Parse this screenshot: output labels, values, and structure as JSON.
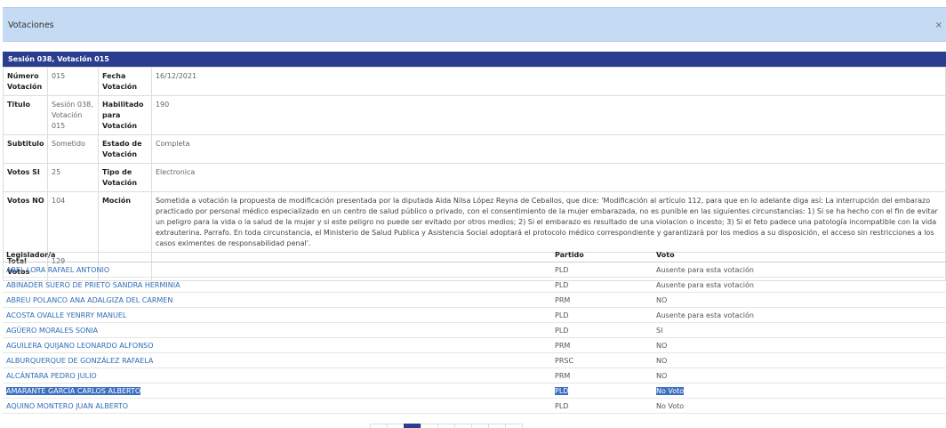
{
  "window": {
    "title": "Votaciones",
    "close": "×"
  },
  "session_title": "Sesión 038, Votación 015",
  "info": {
    "numero_label": "Número Votación",
    "numero": "015",
    "fecha_label": "Fecha Votación",
    "fecha": "16/12/2021",
    "titulo_label": "Titulo",
    "titulo": "Sesión 038, Votación 015",
    "habilitado_label": "Habilitado para Votación",
    "habilitado": "190",
    "subtitulo_label": "Subtitulo",
    "subtitulo": "Sometido",
    "estado_label": "Estado de Votación",
    "estado": "Completa",
    "votos_si_label": "Votos SI",
    "votos_si": "25",
    "tipo_label": "Tipo de Votación",
    "tipo": "Electronica",
    "votos_no_label": "Votos NO",
    "votos_no": "104",
    "mocion_label": "Moción",
    "mocion": "Sometida a votación la propuesta de modificación presentada por la diputada Aida Nilsa López Reyna de Ceballos, que dice: 'Modificación al artículo 112, para que en lo adelante diga así: La interrupción del embarazo practicado por personal médico especializado en un centro de salud público o privado, con el consentimiento de la mujer embarazada, no es punible en las siguientes circunstancias: 1) Si se ha hecho con el fin de evitar un peligro para la vida o la salud de la mujer y si este peligro no puede ser evitado por otros medios; 2) Si el embarazo es resultado de una violacion o incesto; 3) Si el feto padece una patología incompatible con la vida extrauterina. Parrafo. En toda circunstancia, el Ministerio de Salud Publica y Asistencia Social adoptará el protocolo médico correspondiente y garantizará por los medios a su disposición, el acceso sin restricciones a los casos eximentes de responsabilidad penal'.",
    "total_label": "Total Votos",
    "total": "129"
  },
  "votes_table": {
    "headers": {
      "legislador": "Legislador/a",
      "partido": "Partido",
      "voto": "Voto"
    },
    "rows": [
      {
        "name": "ABEL LORA RAFAEL ANTONIO",
        "party": "PLD",
        "vote": "Ausente para esta votación"
      },
      {
        "name": "ABINADER SUERO DE PRIETO SANDRA HERMINIA",
        "party": "PLD",
        "vote": "Ausente para esta votación"
      },
      {
        "name": "ABREU POLANCO ANA ADALGIZA DEL CARMEN",
        "party": "PRM",
        "vote": "NO"
      },
      {
        "name": "ACOSTA OVALLE YENRRY MANUEL",
        "party": "PLD",
        "vote": "Ausente para esta votación"
      },
      {
        "name": "AGÜERO MORALES SONIA",
        "party": "PLD",
        "vote": "SI"
      },
      {
        "name": "AGUILERA QUIJANO LEONARDO ALFONSO",
        "party": "PRM",
        "vote": "NO"
      },
      {
        "name": "ALBURQUERQUE DE GONZÁLEZ RAFAELA",
        "party": "PRSC",
        "vote": "NO"
      },
      {
        "name": "ALCÁNTARA PEDRO JULIO",
        "party": "PRM",
        "vote": "NO"
      },
      {
        "name": "AMARANTE GARCÍA CARLOS ALBERTO",
        "party": "PLD",
        "vote": "No Voto"
      },
      {
        "name": "AQUINO MONTERO JUAN ALBERTO",
        "party": "PLD",
        "vote": "No Voto"
      }
    ]
  },
  "colors": {
    "title_bar": "#c5daf3",
    "session_bar": "#2a3d8f",
    "link": "#2f6db5",
    "selection": "#3b6fc2"
  }
}
